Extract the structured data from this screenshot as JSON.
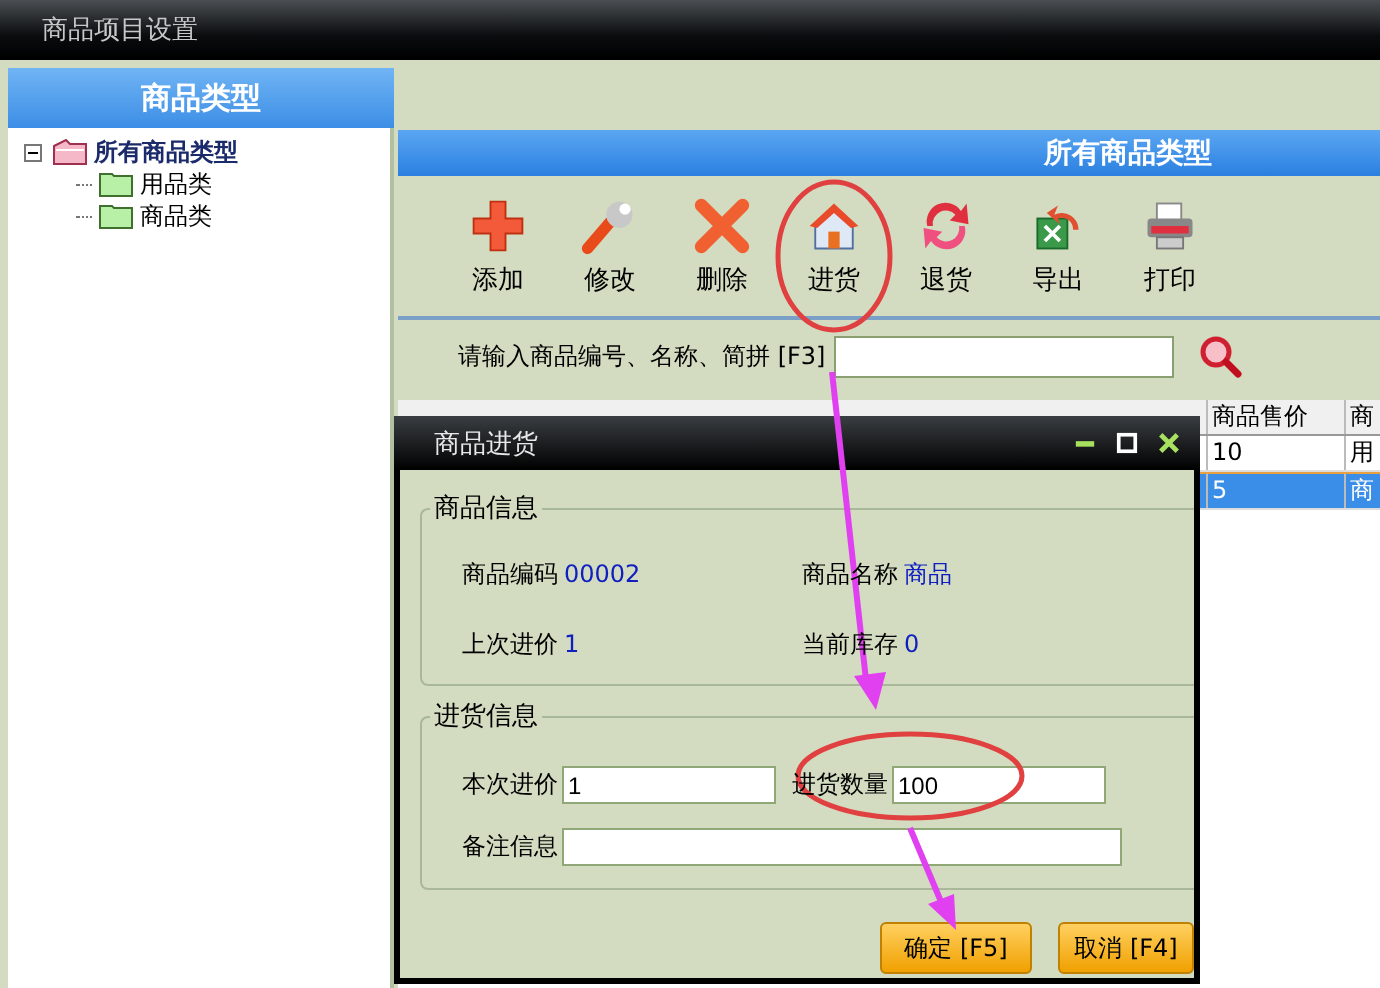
{
  "window": {
    "title": "商品项目设置"
  },
  "sidebar": {
    "title": "商品类型",
    "tree": [
      {
        "label": "所有商品类型",
        "expanded": true,
        "children": [
          {
            "label": "用品类"
          },
          {
            "label": "商品类"
          }
        ]
      }
    ]
  },
  "main": {
    "title": "所有商品类型",
    "toolbar": [
      {
        "label": "添加",
        "kind": "add"
      },
      {
        "label": "修改",
        "kind": "edit"
      },
      {
        "label": "删除",
        "kind": "delete"
      },
      {
        "label": "进货",
        "kind": "stock"
      },
      {
        "label": "退货",
        "kind": "return"
      },
      {
        "label": "导出",
        "kind": "export"
      },
      {
        "label": "打印",
        "kind": "print"
      }
    ],
    "search": {
      "label": "请输入商品编号、名称、简拼 [F3]"
    },
    "table": {
      "columns": [
        "商品售价",
        "商"
      ],
      "rows": [
        {
          "cells": [
            "10",
            "用"
          ],
          "selected": false
        },
        {
          "cells": [
            "5",
            "商"
          ],
          "selected": true
        }
      ]
    }
  },
  "dialog": {
    "title": "商品进货",
    "info": {
      "title": "商品信息",
      "fields": [
        {
          "label": "商品编码",
          "value": "00002"
        },
        {
          "label": "商品名称",
          "value": "商品"
        },
        {
          "label": "上次进价",
          "value": "1"
        },
        {
          "label": "当前库存",
          "value": "0"
        }
      ]
    },
    "entry": {
      "title": "进货信息",
      "price": {
        "label": "本次进价",
        "value": "1"
      },
      "quantity": {
        "label": "进货数量",
        "value": "100"
      },
      "note": {
        "label": "备注信息"
      }
    },
    "buttons": [
      "确定 [F5]",
      "取消 [F4]"
    ]
  }
}
